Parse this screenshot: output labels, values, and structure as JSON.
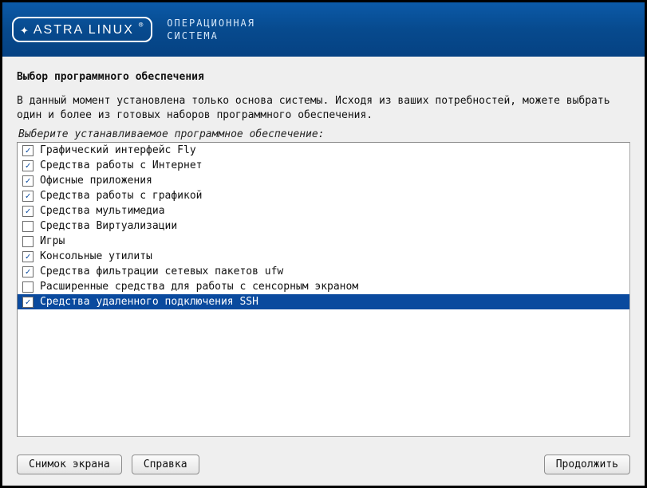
{
  "header": {
    "logo_text": "ASTRA LINUX",
    "tagline_line1": "ОПЕРАЦИОННАЯ",
    "tagline_line2": "СИСТЕМА"
  },
  "page": {
    "title": "Выбор программного обеспечения",
    "intro": "В данный момент установлена только основа системы. Исходя из ваших потребностей, можете выбрать один и более из готовых наборов программного обеспечения.",
    "prompt": "Выберите устанавливаемое программное обеспечение:"
  },
  "software": [
    {
      "label": "Графический интерфейс Fly",
      "checked": true,
      "selected": false
    },
    {
      "label": "Средства работы с Интернет",
      "checked": true,
      "selected": false
    },
    {
      "label": "Офисные приложения",
      "checked": true,
      "selected": false
    },
    {
      "label": "Средства работы с графикой",
      "checked": true,
      "selected": false
    },
    {
      "label": "Средства мультимедиа",
      "checked": true,
      "selected": false
    },
    {
      "label": "Средства Виртуализации",
      "checked": false,
      "selected": false
    },
    {
      "label": "Игры",
      "checked": false,
      "selected": false
    },
    {
      "label": "Консольные утилиты",
      "checked": true,
      "selected": false
    },
    {
      "label": "Средства фильтрации сетевых пакетов ufw",
      "checked": true,
      "selected": false
    },
    {
      "label": "Расширенные средства для работы с сенсорным экраном",
      "checked": false,
      "selected": false
    },
    {
      "label": "Средства удаленного подключения SSH",
      "checked": true,
      "selected": true
    }
  ],
  "buttons": {
    "screenshot": "Снимок экрана",
    "help": "Справка",
    "continue": "Продолжить"
  }
}
